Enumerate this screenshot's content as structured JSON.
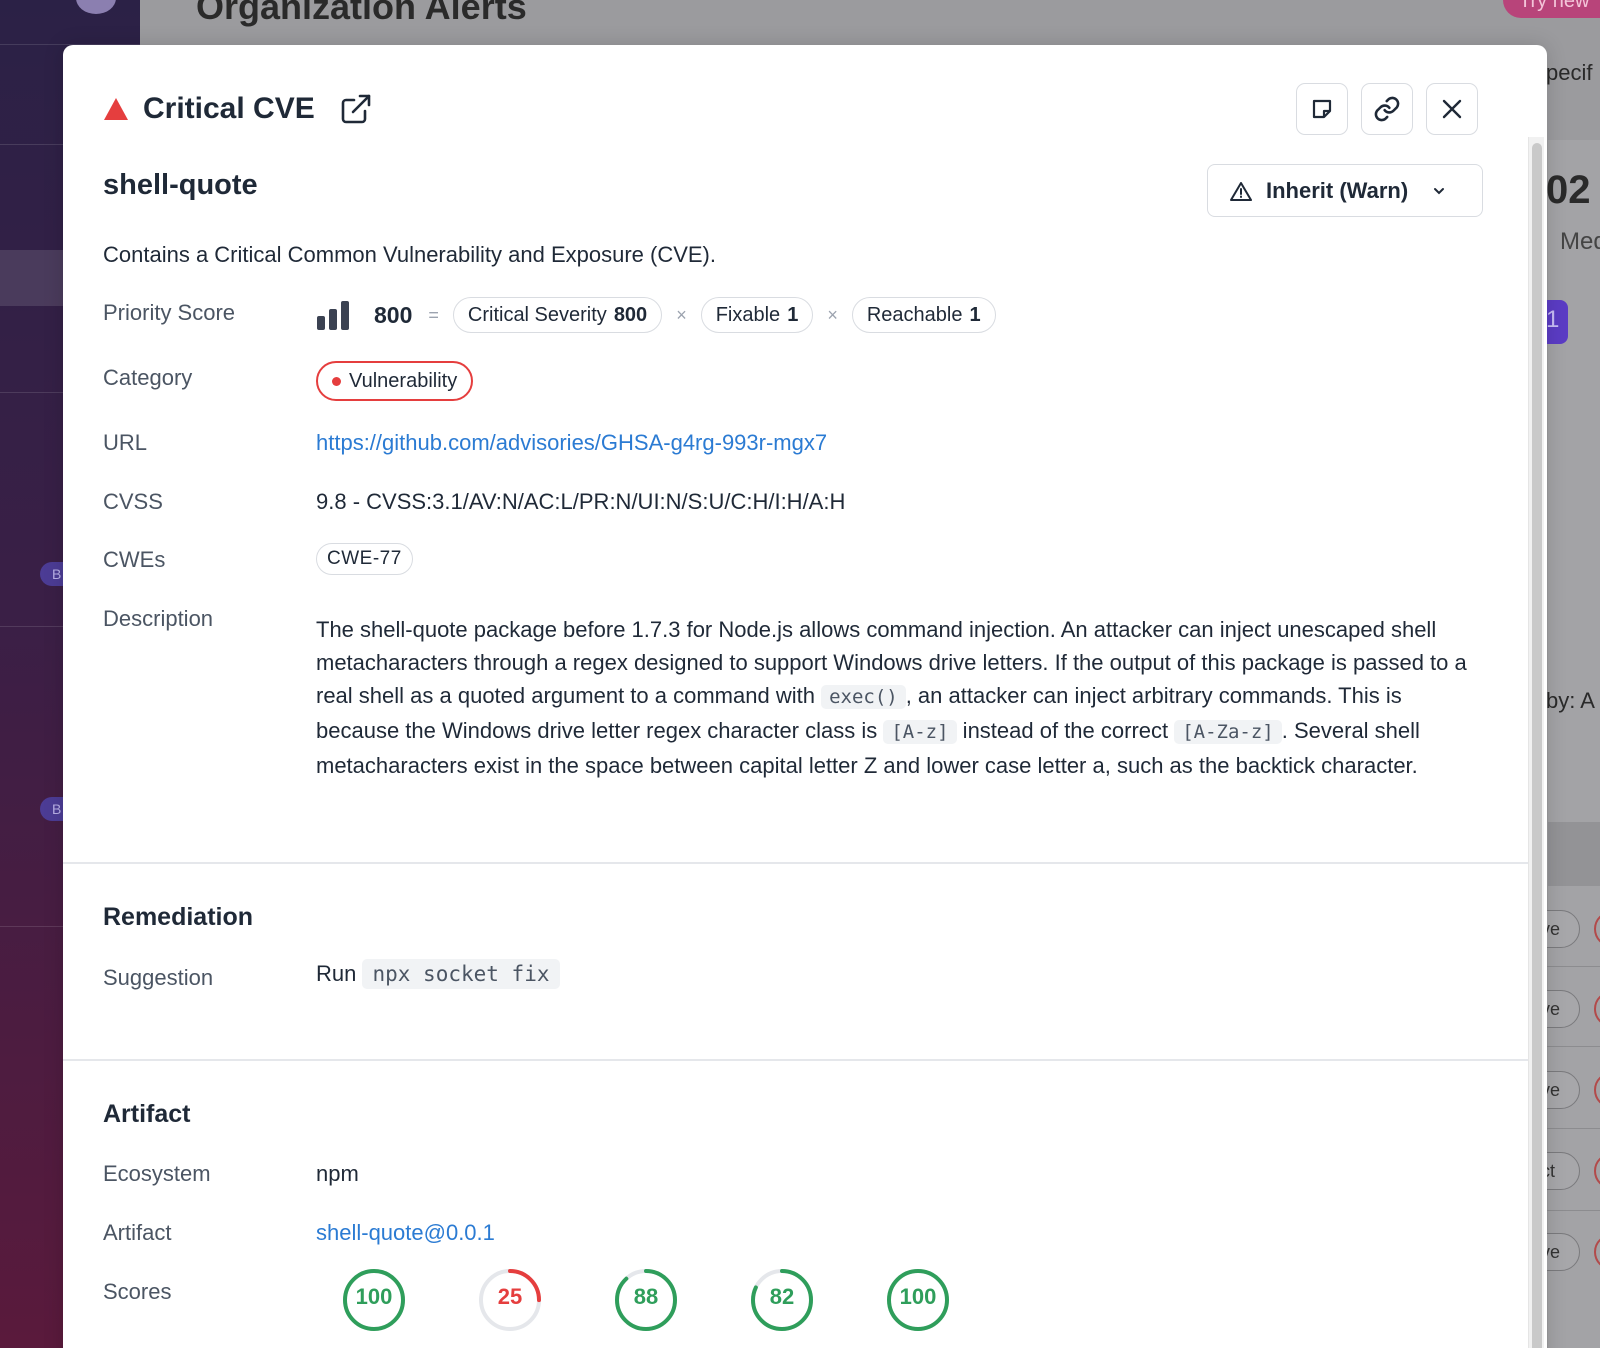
{
  "background": {
    "page_title": "Organization Alerts",
    "try_new": "Try new",
    "badge_1": "B",
    "badge_2": "B",
    "right_fragments": [
      "pecif",
      "02",
      "Med",
      "1",
      "by: A"
    ],
    "right_pills": [
      "ve",
      "ve",
      "ve",
      "ct",
      "ve"
    ]
  },
  "modal": {
    "alert_title": "Critical CVE",
    "package_name": "shell-quote",
    "action_select": "Inherit (Warn)",
    "summary": "Contains a Critical Common Vulnerability and Exposure (CVE).",
    "details": {
      "priority_label": "Priority Score",
      "priority_value": "800",
      "priority_eq": "=",
      "priority_times": "×",
      "factors": [
        {
          "label": "Critical Severity",
          "value": "800"
        },
        {
          "label": "Fixable",
          "value": "1"
        },
        {
          "label": "Reachable",
          "value": "1"
        }
      ],
      "category_label": "Category",
      "category_value": "Vulnerability",
      "url_label": "URL",
      "url_value": "https://github.com/advisories/GHSA-g4rg-993r-mgx7",
      "cvss_label": "CVSS",
      "cvss_value": "9.8 - CVSS:3.1/AV:N/AC:L/PR:N/UI:N/S:U/C:H/I:H/A:H",
      "cwes_label": "CWEs",
      "cwe_value": "CWE-77",
      "description_label": "Description",
      "description": {
        "p1": "The shell-quote package before 1.7.3 for Node.js allows command injection. An attacker can inject unescaped shell metacharacters through a regex designed to support Windows drive letters. If the output of this package is passed to a real shell as a quoted argument to a command with ",
        "code1": "exec()",
        "p2": ", an attacker can inject arbitrary commands. This is because the Windows drive letter regex character class is ",
        "code2": "[A-z]",
        "p3": " instead of the correct ",
        "code3": "[A-Za-z]",
        "p4": ". Several shell metacharacters exist in the space between capital letter Z and lower case letter a, such as the backtick character."
      }
    },
    "remediation": {
      "title": "Remediation",
      "suggestion_label": "Suggestion",
      "run_text": "Run",
      "command": "npx socket fix"
    },
    "artifact": {
      "title": "Artifact",
      "ecosystem_label": "Ecosystem",
      "ecosystem_value": "npm",
      "artifact_label": "Artifact",
      "artifact_value": "shell-quote@0.0.1",
      "scores_label": "Scores",
      "scores": [
        {
          "value": "100",
          "fraction": 1.0,
          "color": "#2f9e5b"
        },
        {
          "value": "25",
          "fraction": 0.25,
          "color": "#e53e3e"
        },
        {
          "value": "88",
          "fraction": 0.88,
          "color": "#2f9e5b"
        },
        {
          "value": "82",
          "fraction": 0.82,
          "color": "#2f9e5b"
        },
        {
          "value": "100",
          "fraction": 1.0,
          "color": "#2f9e5b"
        }
      ]
    },
    "icons": {
      "note": "sticky-note-icon",
      "link": "link-icon",
      "close": "close-icon",
      "external": "external-link-icon",
      "alert": "warning-triangle-icon"
    }
  }
}
